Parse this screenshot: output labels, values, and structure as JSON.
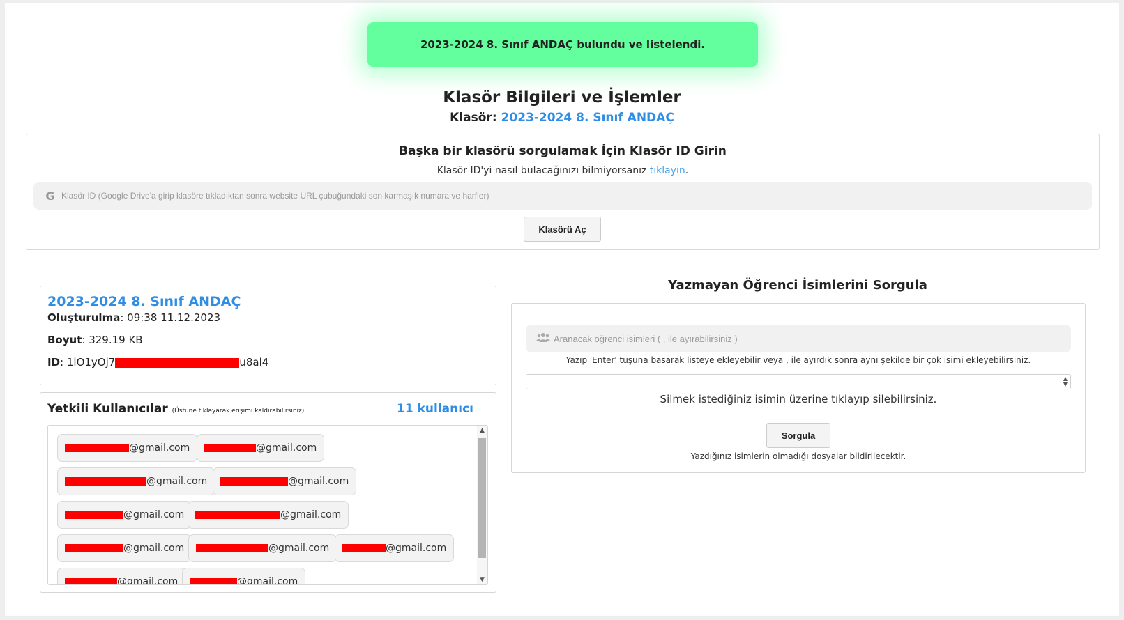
{
  "toast": {
    "message": "2023-2024 8. Sınıf ANDAÇ bulundu ve listelendi."
  },
  "page": {
    "title": "Klasör Bilgileri ve İşlemler",
    "folder_label": "Klasör:",
    "folder_name": "2023-2024 8. Sınıf ANDAÇ"
  },
  "query": {
    "heading": "Başka bir klasörü sorgulamak İçin Klasör ID Girin",
    "help_text": "Klasör ID'yi nasıl bulacağınızı bilmiyorsanız",
    "help_link": "tıklayın",
    "help_end": ".",
    "input_icon": "G",
    "input_placeholder": "Klasör ID (Google Drive'a girip klasöre tıkladıktan sonra website URL çubuğundaki son karmaşık numara ve harfler)",
    "open_button": "Klasörü Aç"
  },
  "info": {
    "name": "2023-2024 8. Sınıf ANDAÇ",
    "created_label": "Oluşturulma",
    "created_value": ": 09:38 11.12.2023",
    "size_label": "Boyut",
    "size_value": ": 329.19 KB",
    "id_label": "ID",
    "id_prefix": ": 1lO1yOj7",
    "id_suffix": "u8al4"
  },
  "users": {
    "title": "Yetkili Kullanıcılar",
    "subtitle": "(Üstüne tıklayarak erişimi kaldırabilirsiniz)",
    "count": "11 kullanıcı",
    "items": [
      {
        "domain": "@gmail.com"
      },
      {
        "domain": "@gmail.com"
      },
      {
        "domain": "@gmail.com"
      },
      {
        "domain": "@gmail.com"
      },
      {
        "domain": "@gmail.com"
      },
      {
        "domain": "@gmail.com"
      },
      {
        "domain": "@gmail.com"
      },
      {
        "domain": "@gmail.com"
      },
      {
        "domain": "@gmail.com"
      },
      {
        "domain": "@gmail.com"
      },
      {
        "domain": "@gmail.com"
      }
    ]
  },
  "names_query": {
    "title": "Yazmayan Öğrenci İsimlerini Sorgula",
    "input_placeholder": "Aranacak öğrenci isimleri ( , ile ayırabilirsiniz )",
    "hint_add": "Yazıp 'Enter' tuşuna basarak listeye ekleyebilir veya , ile ayırdık sonra aynı şekilde bir çok isimi ekleyebilirsiniz.",
    "hint_delete": "Silmek istediğiniz isimin üzerine tıklayıp silebilirsiniz.",
    "query_button": "Sorgula",
    "hint_result": "Yazdığınız isimlerin olmadığı dosyalar bildirilecektir."
  },
  "colors": {
    "toast_bg": "#63ff9e",
    "link": "#2f8de4",
    "redaction": "#ff0000"
  }
}
